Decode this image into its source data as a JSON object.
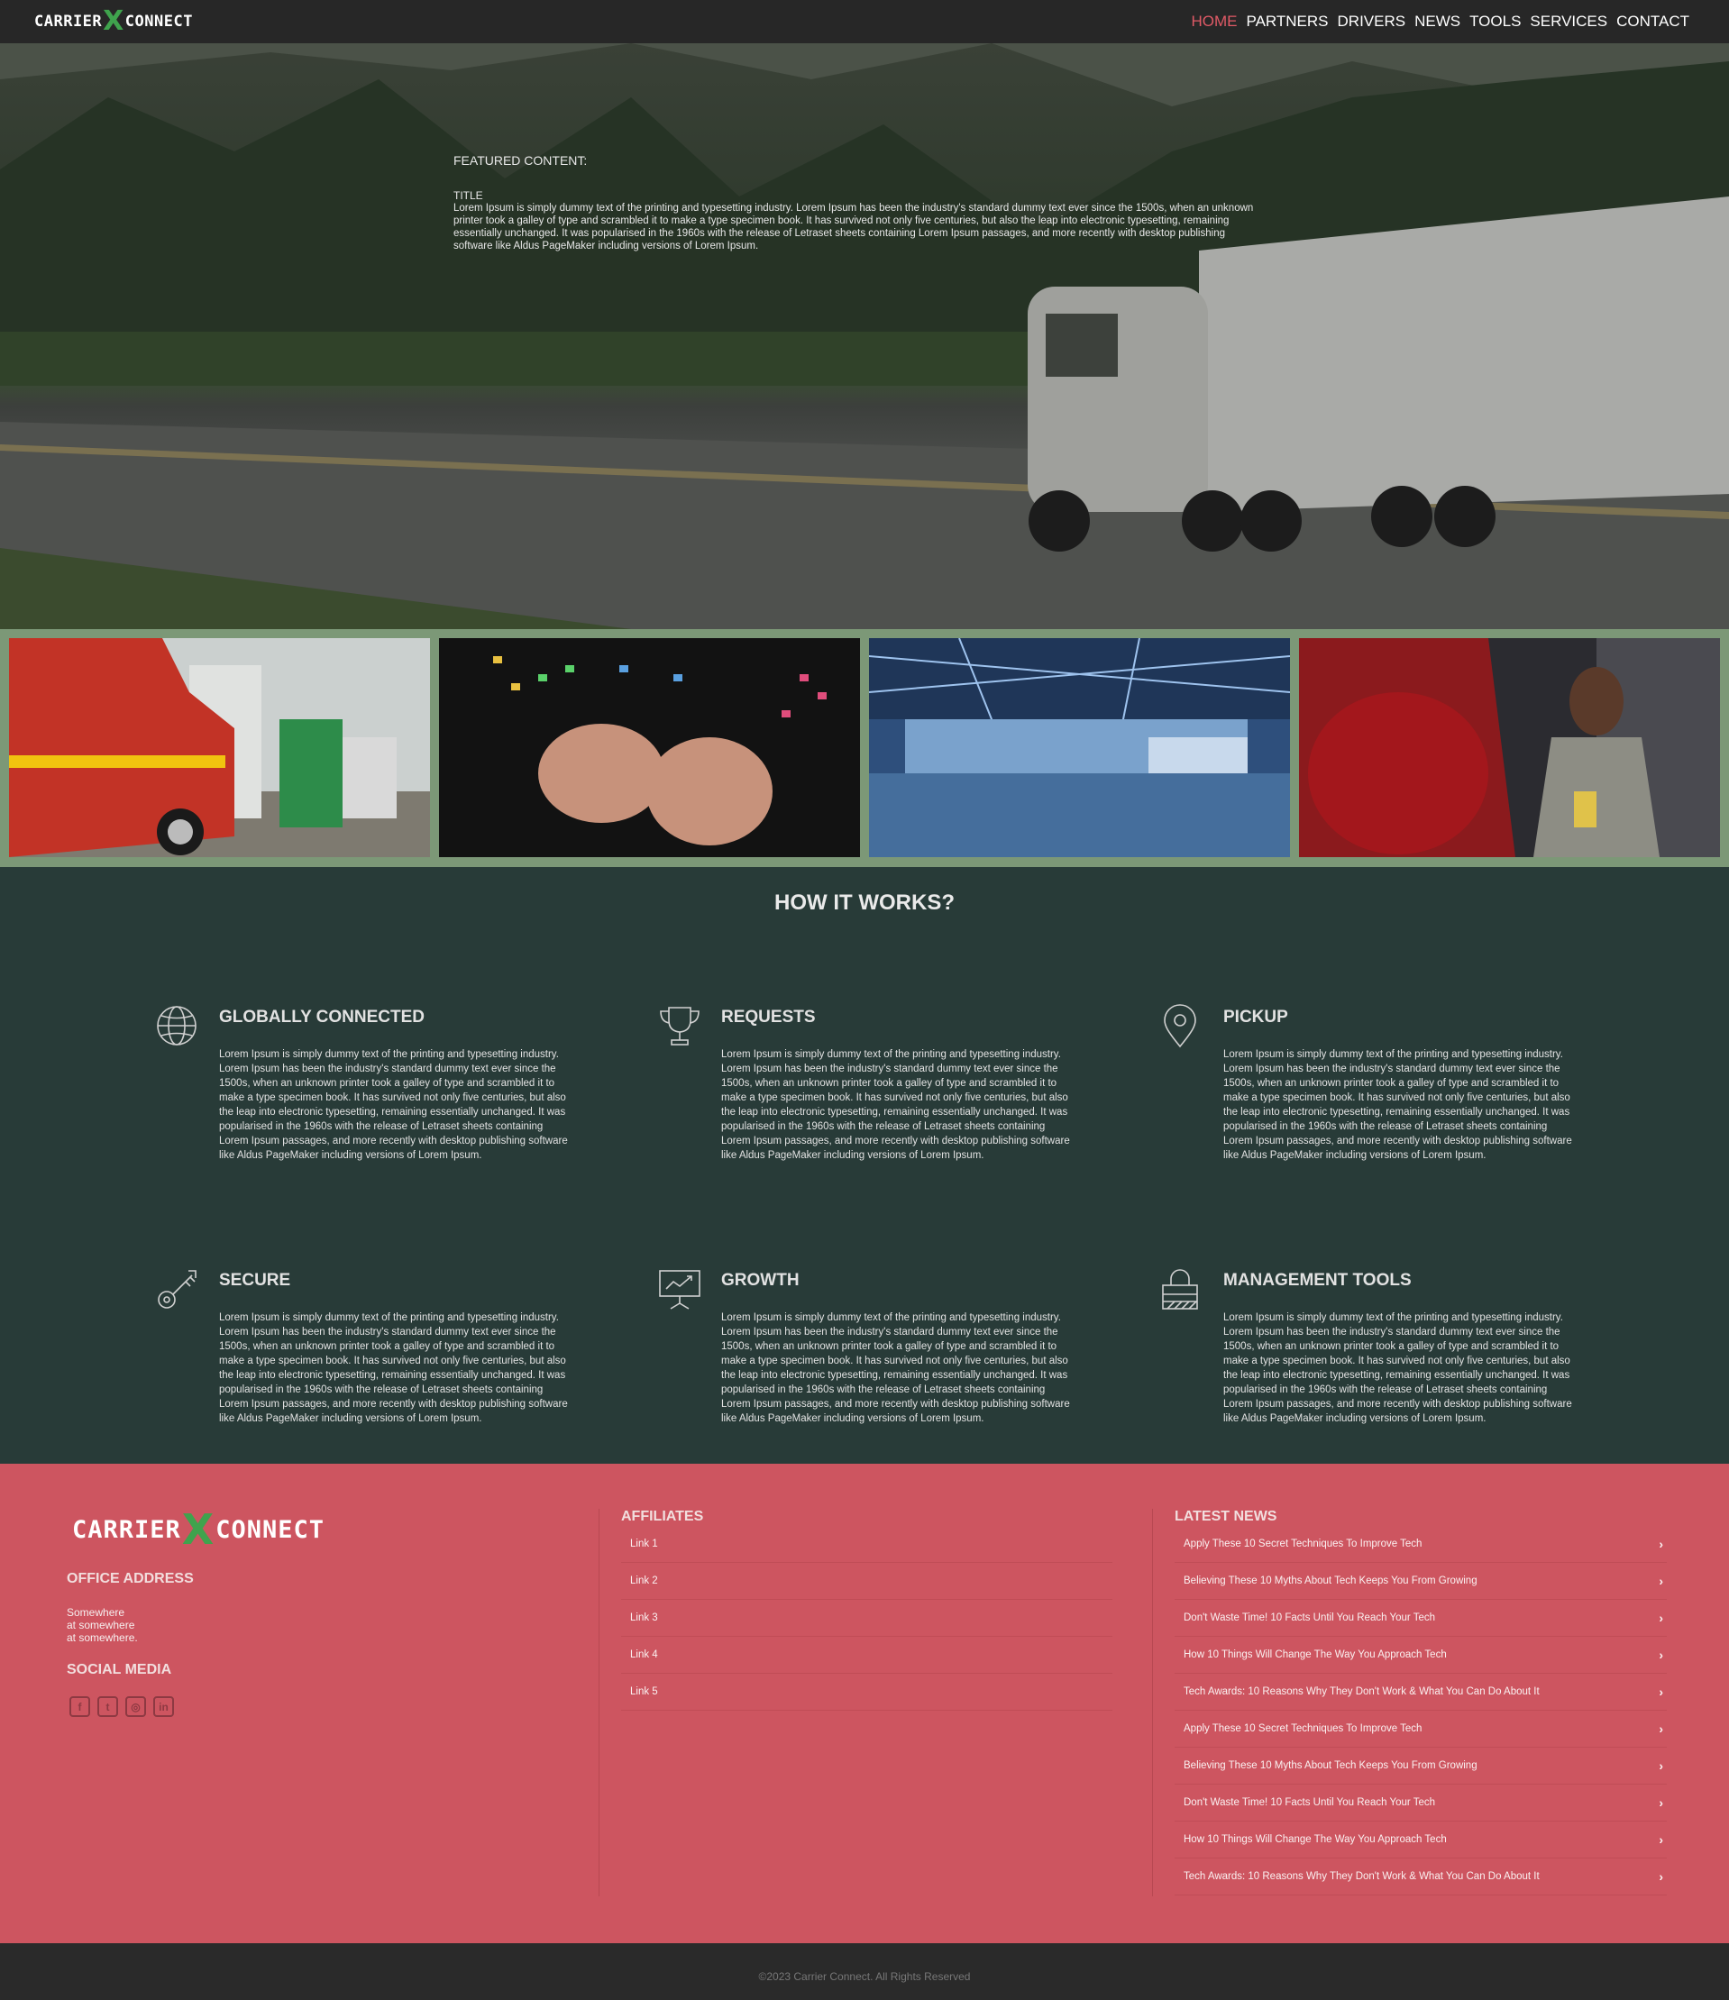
{
  "brand": {
    "part1": "CARRIER",
    "x": "X",
    "part2": "CONNECT"
  },
  "nav": {
    "items": [
      "HOME",
      "PARTNERS",
      "DRIVERS",
      "NEWS",
      "TOOLS",
      "SERVICES",
      "CONTACT"
    ],
    "active": "HOME",
    "active_color": "#e05a66"
  },
  "hero": {
    "label": "FEATURED CONTENT:",
    "title": "TITLE",
    "body": "Lorem Ipsum is simply dummy text of the printing and typesetting industry. Lorem Ipsum has been the industry's standard dummy text ever since the 1500s, when an unknown printer took a galley of type and scrambled it to make a type specimen book. It has survived not only five centuries, but also the leap into electronic typesetting, remaining essentially unchanged. It was popularised in the 1960s with the release of Letraset sheets containing Lorem Ipsum passages, and more recently with desktop publishing software like Aldus PageMaker including versions of Lorem Ipsum."
  },
  "how": {
    "title": "HOW IT WORKS?",
    "features": [
      {
        "icon": "globe-icon",
        "title": "GLOBALLY CONNECTED",
        "body": "Lorem Ipsum is simply dummy text of the printing and typesetting industry. Lorem Ipsum has been the industry's standard dummy text ever since the 1500s, when an unknown printer took a galley of type and scrambled it to make a type specimen book. It has survived not only five centuries, but also the leap into electronic typesetting, remaining essentially unchanged. It was popularised in the 1960s with the release of Letraset sheets containing Lorem Ipsum passages, and more recently with desktop publishing software like Aldus PageMaker including versions of Lorem Ipsum."
      },
      {
        "icon": "trophy-icon",
        "title": "REQUESTS",
        "body": "Lorem Ipsum is simply dummy text of the printing and typesetting industry. Lorem Ipsum has been the industry's standard dummy text ever since the 1500s, when an unknown printer took a galley of type and scrambled it to make a type specimen book. It has survived not only five centuries, but also the leap into electronic typesetting, remaining essentially unchanged. It was popularised in the 1960s with the release of Letraset sheets containing Lorem Ipsum passages, and more recently with desktop publishing software like Aldus PageMaker including versions of Lorem Ipsum."
      },
      {
        "icon": "map-pin-icon",
        "title": "PICKUP",
        "body": "Lorem Ipsum is simply dummy text of the printing and typesetting industry. Lorem Ipsum has been the industry's standard dummy text ever since the 1500s, when an unknown printer took a galley of type and scrambled it to make a type specimen book. It has survived not only five centuries, but also the leap into electronic typesetting, remaining essentially unchanged. It was popularised in the 1960s with the release of Letraset sheets containing Lorem Ipsum passages, and more recently with desktop publishing software like Aldus PageMaker including versions of Lorem Ipsum."
      },
      {
        "icon": "key-icon",
        "title": "SECURE",
        "body": "Lorem Ipsum is simply dummy text of the printing and typesetting industry. Lorem Ipsum has been the industry's standard dummy text ever since the 1500s, when an unknown printer took a galley of type and scrambled it to make a type specimen book. It has survived not only five centuries, but also the leap into electronic typesetting, remaining essentially unchanged. It was popularised in the 1960s with the release of Letraset sheets containing Lorem Ipsum passages, and more recently with desktop publishing software like Aldus PageMaker including versions of Lorem Ipsum."
      },
      {
        "icon": "presentation-chart-icon",
        "title": "GROWTH",
        "body": "Lorem Ipsum is simply dummy text of the printing and typesetting industry. Lorem Ipsum has been the industry's standard dummy text ever since the 1500s, when an unknown printer took a galley of type and scrambled it to make a type specimen book. It has survived not only five centuries, but also the leap into electronic typesetting, remaining essentially unchanged. It was popularised in the 1960s with the release of Letraset sheets containing Lorem Ipsum passages, and more recently with desktop publishing software like Aldus PageMaker including versions of Lorem Ipsum."
      },
      {
        "icon": "padlock-icon",
        "title": "MANAGEMENT TOOLS",
        "body": "Lorem Ipsum is simply dummy text of the printing and typesetting industry. Lorem Ipsum has been the industry's standard dummy text ever since the 1500s, when an unknown printer took a galley of type and scrambled it to make a type specimen book. It has survived not only five centuries, but also the leap into electronic typesetting, remaining essentially unchanged. It was popularised in the 1960s with the release of Letraset sheets containing Lorem Ipsum passages, and more recently with desktop publishing software like Aldus PageMaker including versions of Lorem Ipsum."
      }
    ]
  },
  "footer": {
    "office_heading": "OFFICE ADDRESS",
    "address": [
      "Somewhere",
      "at somewhere",
      "at somewhere."
    ],
    "social_heading": "SOCIAL MEDIA",
    "social": [
      "facebook-icon",
      "twitter-icon",
      "instagram-icon",
      "linkedin-icon"
    ],
    "affiliates_heading": "AFFILIATES",
    "affiliates": [
      "Link 1",
      "Link 2",
      "Link 3",
      "Link 4",
      "Link 5"
    ],
    "news_heading": "LATEST NEWS",
    "news": [
      "Apply These 10 Secret Techniques To Improve Tech",
      "Believing These 10 Myths About Tech Keeps You From Growing",
      "Don't Waste Time! 10 Facts Until You Reach Your Tech",
      "How 10 Things Will Change The Way You Approach Tech",
      "Tech Awards: 10 Reasons Why They Don't Work & What You Can Do About It",
      "Apply These 10 Secret Techniques To Improve Tech",
      "Believing These 10 Myths About Tech Keeps You From Growing",
      "Don't Waste Time! 10 Facts Until You Reach Your Tech",
      "How 10 Things Will Change The Way You Approach Tech",
      "Tech Awards: 10 Reasons Why They Don't Work & What You Can Do About It"
    ],
    "chevron": "›"
  },
  "copyright": "©2023 Carrier Connect. All Rights Reserved",
  "colors": {
    "nav_bg": "#272727",
    "accent": "#e05a66",
    "strip": "#7c9877",
    "how_bg": "#283b38",
    "footer_bg": "#cd5560",
    "logo_x": "#3fa34d"
  }
}
